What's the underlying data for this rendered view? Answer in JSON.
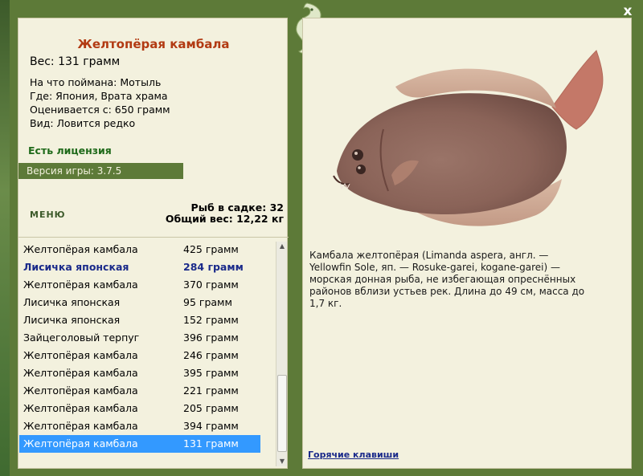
{
  "window": {
    "close_label": "x"
  },
  "fish": {
    "title": "Желтопёрая камбала",
    "weight": "Вес: 131 грамм",
    "caught_on": "На что поймана: Мотыль",
    "location": "Где: Япония, Врата храма",
    "valued_from": "Оценивается с: 650 грамм",
    "rarity": "Вид: Ловится редко"
  },
  "license_label": "Есть лицензия",
  "version_label": "Версия игры: 3.7.5",
  "menu_label": "МЕНЮ",
  "stats": {
    "fish_in_cage": "Рыб в садке: 32",
    "total_weight": "Общий вес: 12,22 кг"
  },
  "catch_list": [
    {
      "name": "Желтопёрая камбала",
      "weight": "425 грамм",
      "style": "normal"
    },
    {
      "name": "Лисичка японская",
      "weight": "284 грамм",
      "style": "bold"
    },
    {
      "name": "Желтопёрая камбала",
      "weight": "370 грамм",
      "style": "normal"
    },
    {
      "name": "Лисичка японская",
      "weight": "95 грамм",
      "style": "normal"
    },
    {
      "name": "Лисичка японская",
      "weight": "152 грамм",
      "style": "normal"
    },
    {
      "name": "Зайцеголовый терпуг",
      "weight": "396 грамм",
      "style": "normal"
    },
    {
      "name": "Желтопёрая камбала",
      "weight": "246 грамм",
      "style": "normal"
    },
    {
      "name": "Желтопёрая камбала",
      "weight": "395 грамм",
      "style": "normal"
    },
    {
      "name": "Желтопёрая камбала",
      "weight": "221 грамм",
      "style": "normal"
    },
    {
      "name": "Желтопёрая камбала",
      "weight": "205 грамм",
      "style": "normal"
    },
    {
      "name": "Желтопёрая камбала",
      "weight": "394 грамм",
      "style": "normal"
    },
    {
      "name": "Желтопёрая камбала",
      "weight": "131 грамм",
      "style": "selected"
    }
  ],
  "description": "Камбала желтопёрая (Limanda aspera, англ. — Yellowfin Sole, яп. — Rosuke-garei, kogane-garei) — морская донная рыба, не избегающая опреснённых районов вблизи устьев рек. Длина до 49 см, масса до 1,7 кг.",
  "hotkeys_label": "Горячие клавиши",
  "colors": {
    "frame": "#5d7a38",
    "panel": "#f3f1de",
    "title": "#b23a12",
    "license": "#1f6a1a",
    "link": "#1a2a8a",
    "selection": "#3399ff"
  },
  "icons": [
    "dragon-emblem-icon",
    "close-icon",
    "scroll-up-icon",
    "scroll-down-icon"
  ]
}
